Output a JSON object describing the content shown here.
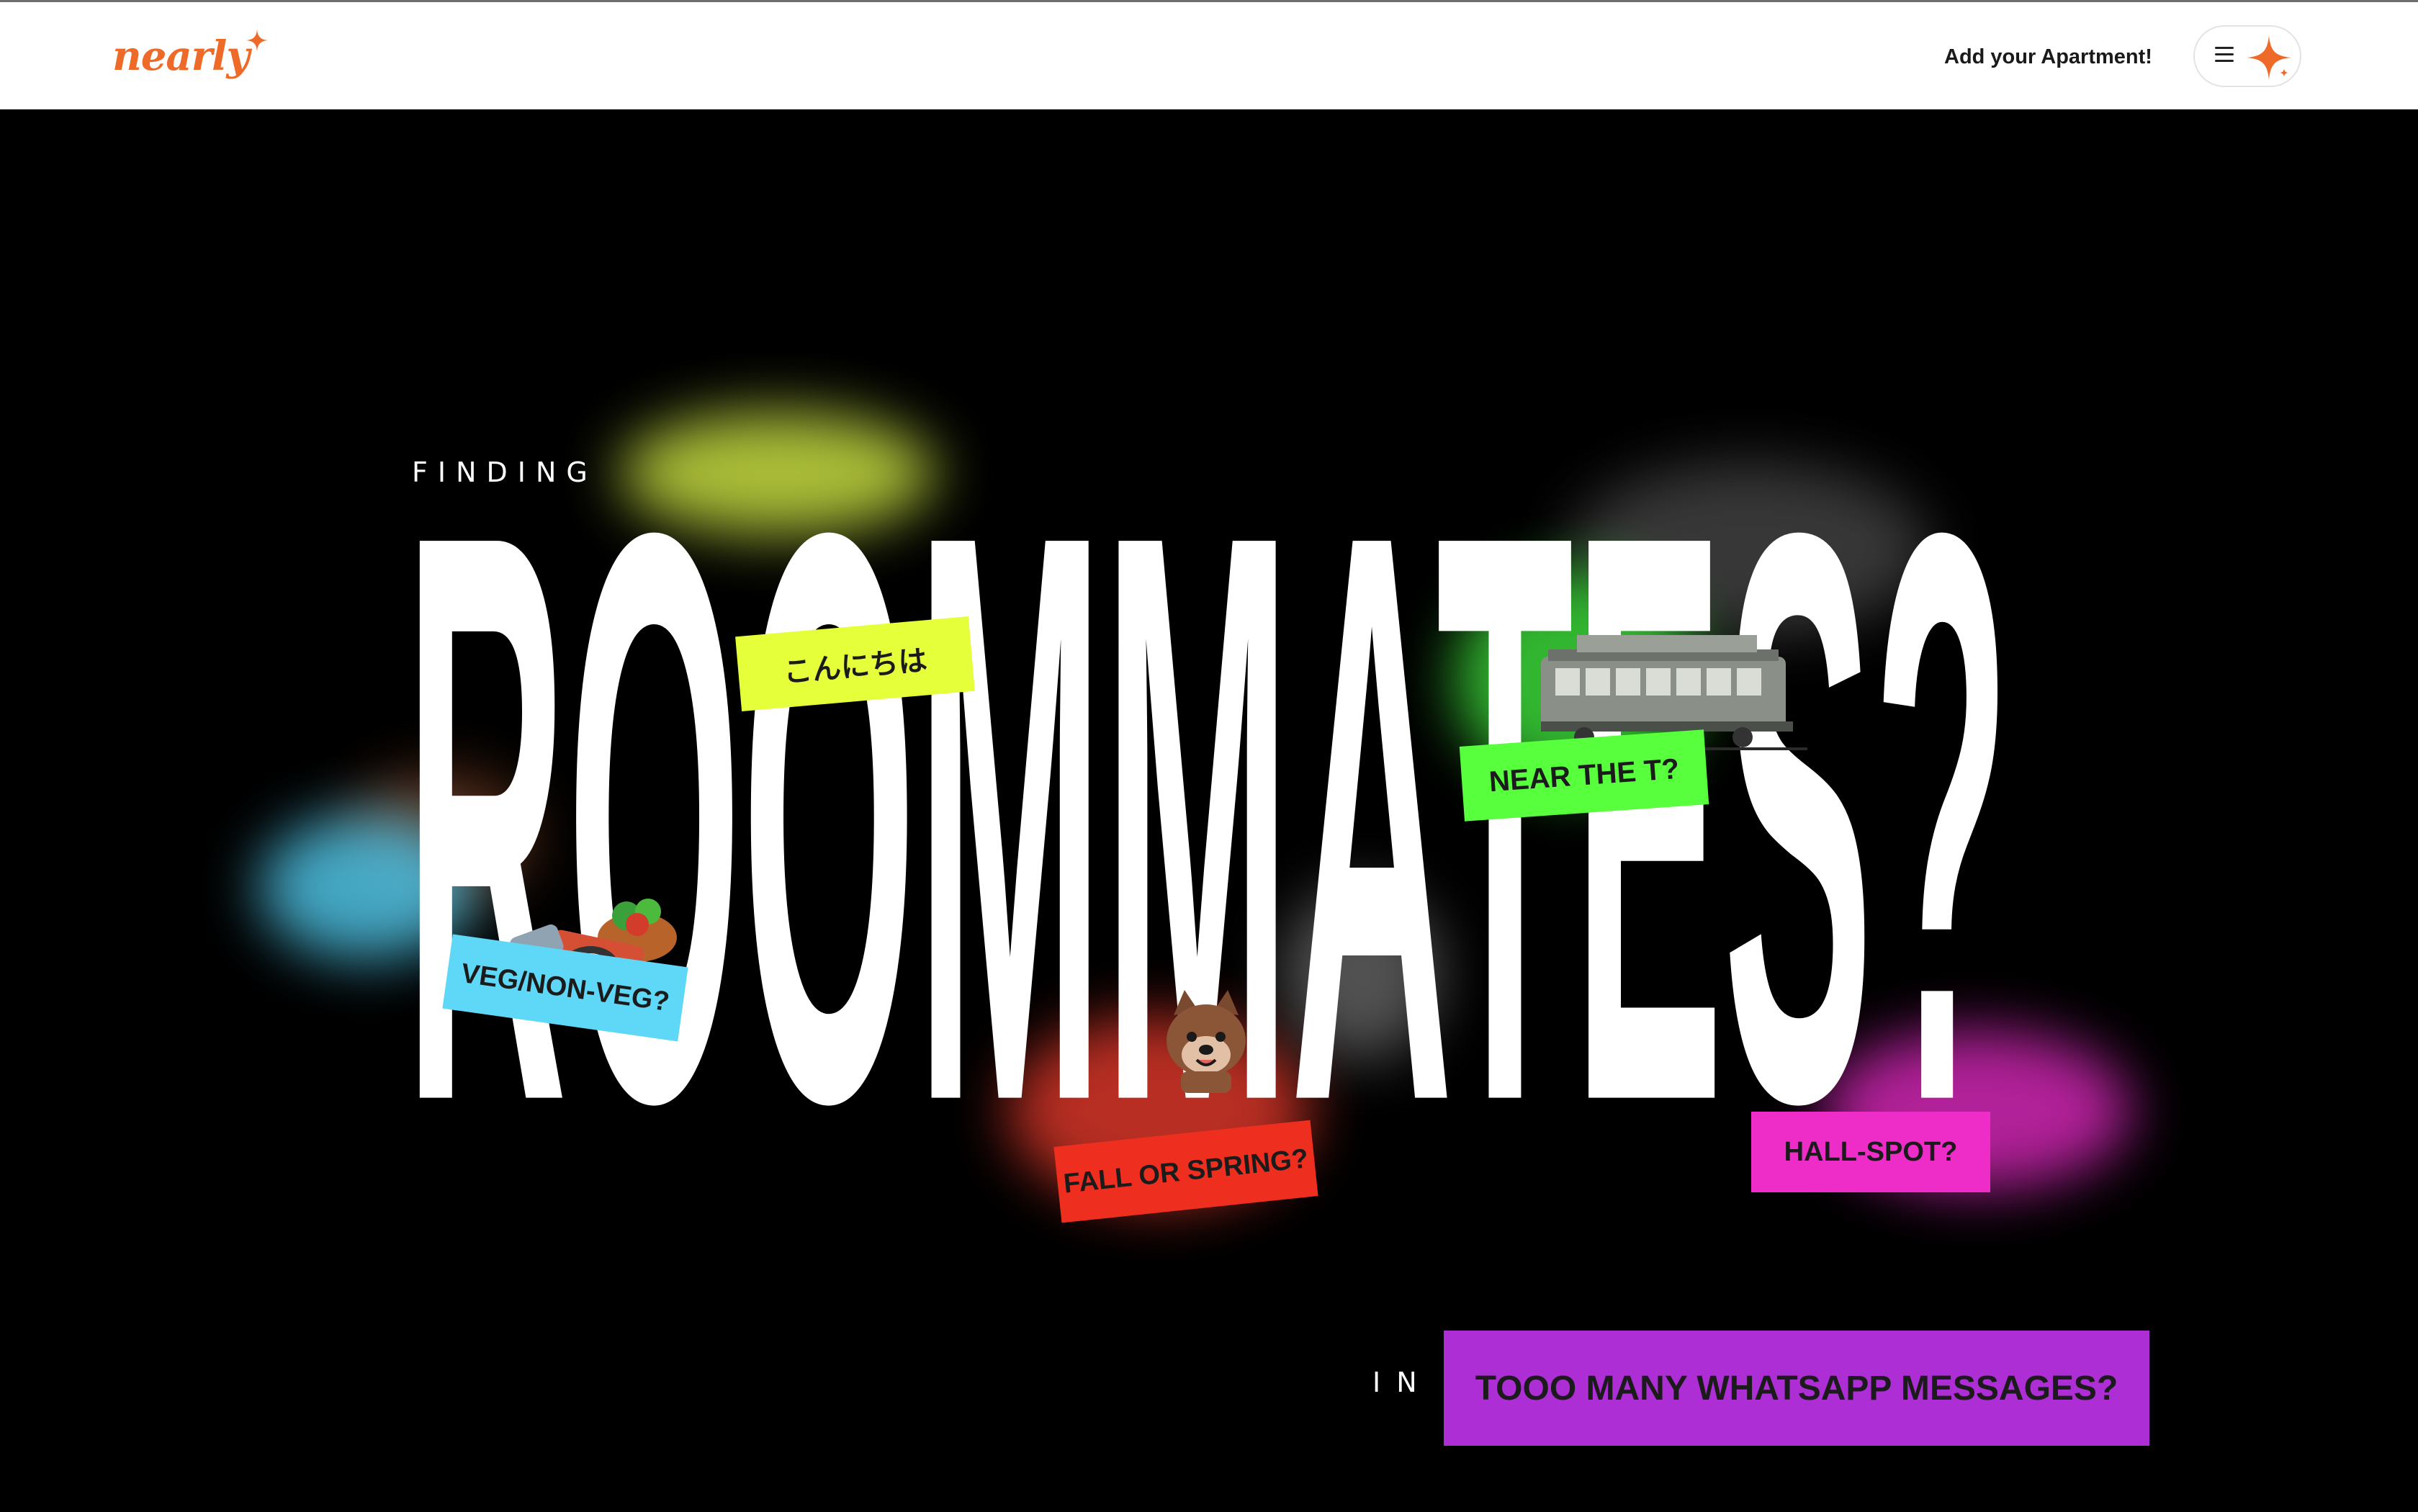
{
  "header": {
    "logo_text": "nearly",
    "add_apartment_label": "Add your Apartment!",
    "menu_icon": "hamburger-icon",
    "sparkle_icon": "sparkle-icon",
    "brand_color": "#ee6a28"
  },
  "hero": {
    "eyebrow": "FINDING",
    "headline": "ROOMMATES?",
    "sub_partial": "IN T",
    "stickers": {
      "greeting": "こんにちは",
      "near_t": "NEAR THE T?",
      "veg": "VEG/NON-VEG?",
      "fall_spring": "FALL OR SPRING?",
      "hall_spot": "HALL-SPOT?",
      "whatsapp": "TOOO MANY WHATSAPP MESSAGES?"
    },
    "sticker_colors": {
      "greeting": "#e6ff3b",
      "near_t": "#57ff3d",
      "veg": "#5fd8f7",
      "fall_spring": "#ee2e1f",
      "hall_spot": "#ee2cc8",
      "whatsapp": "#ad2ed4"
    },
    "images": [
      "tram-image",
      "food-image",
      "dog-image"
    ]
  }
}
